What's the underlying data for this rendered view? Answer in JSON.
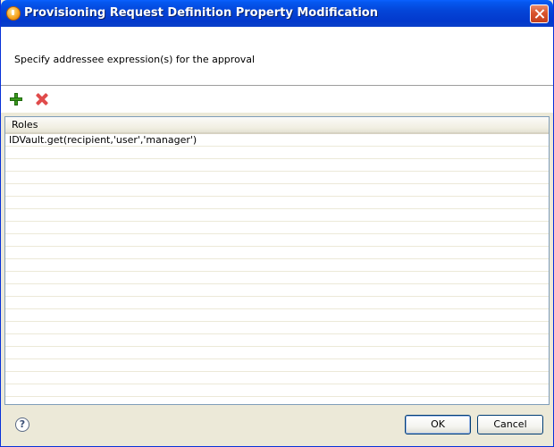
{
  "window": {
    "title": "Provisioning Request Definition Property Modification"
  },
  "message": "Specify addressee expression(s) for the approval",
  "toolbar": {
    "add_icon": "add-icon",
    "remove_icon": "remove-icon"
  },
  "table": {
    "columns": [
      "Roles"
    ],
    "rows": [
      "IDVault.get(recipient,'user','manager')",
      "",
      "",
      "",
      "",
      "",
      "",
      "",
      "",
      "",
      "",
      "",
      "",
      "",
      "",
      "",
      "",
      "",
      "",
      "",
      "",
      "",
      ""
    ]
  },
  "buttons": {
    "ok_label": "OK",
    "cancel_label": "Cancel",
    "help_label": "?"
  },
  "colors": {
    "titlebar": "#0445d8",
    "close_button": "#d9532c",
    "add_icon": "#3c9a1e",
    "remove_icon": "#e04b4b"
  }
}
